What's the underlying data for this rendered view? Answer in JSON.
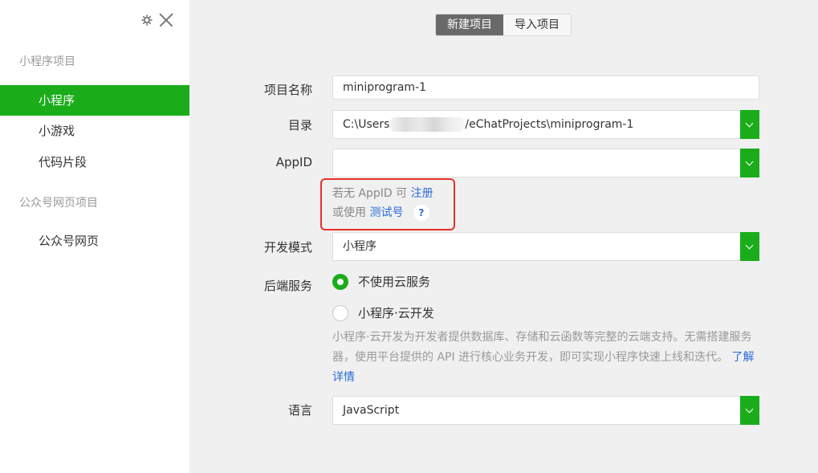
{
  "sidebar": {
    "section_miniprogram": "小程序项目",
    "items_mp": [
      {
        "label": "小程序"
      },
      {
        "label": "小游戏"
      },
      {
        "label": "代码片段"
      }
    ],
    "section_web": "公众号网页项目",
    "items_web": [
      {
        "label": "公众号网页"
      }
    ],
    "active_item": "小程序"
  },
  "tabs": [
    {
      "label": "新建项目",
      "active": true
    },
    {
      "label": "导入项目",
      "active": false
    }
  ],
  "form": {
    "name_label": "项目名称",
    "name_value": "miniprogram-1",
    "dir_label": "目录",
    "dir_value_prefix": "C:\\Users",
    "dir_value_suffix": "/eChatProjects\\miniprogram-1",
    "appid_label": "AppID",
    "appid_value": "",
    "appid_hint_1": "若无 AppID 可",
    "appid_register_link": "注册",
    "appid_hint_2": "或使用",
    "appid_test_link": "测试号",
    "help_mark": "?",
    "mode_label": "开发模式",
    "mode_value": "小程序",
    "backend_label": "后端服务",
    "backend_options": [
      {
        "label": "不使用云服务",
        "selected": true
      },
      {
        "label": "小程序·云开发",
        "selected": false
      }
    ],
    "cloud_desc": "小程序·云开发为开发者提供数据库、存储和云函数等完整的云端支持。无需搭建服务器，使用平台提供的 API 进行核心业务开发，即可实现小程序快速上线和迭代。",
    "cloud_learn_more": "了解详情",
    "lang_label": "语言",
    "lang_value": "JavaScript"
  },
  "colors": {
    "accent": "#1aad19",
    "link": "#2b6bd8",
    "highlight_box": "#e8312a"
  },
  "icons": {
    "settings": "gear-icon",
    "close": "close-icon",
    "dropdown": "chevron-down-icon"
  }
}
